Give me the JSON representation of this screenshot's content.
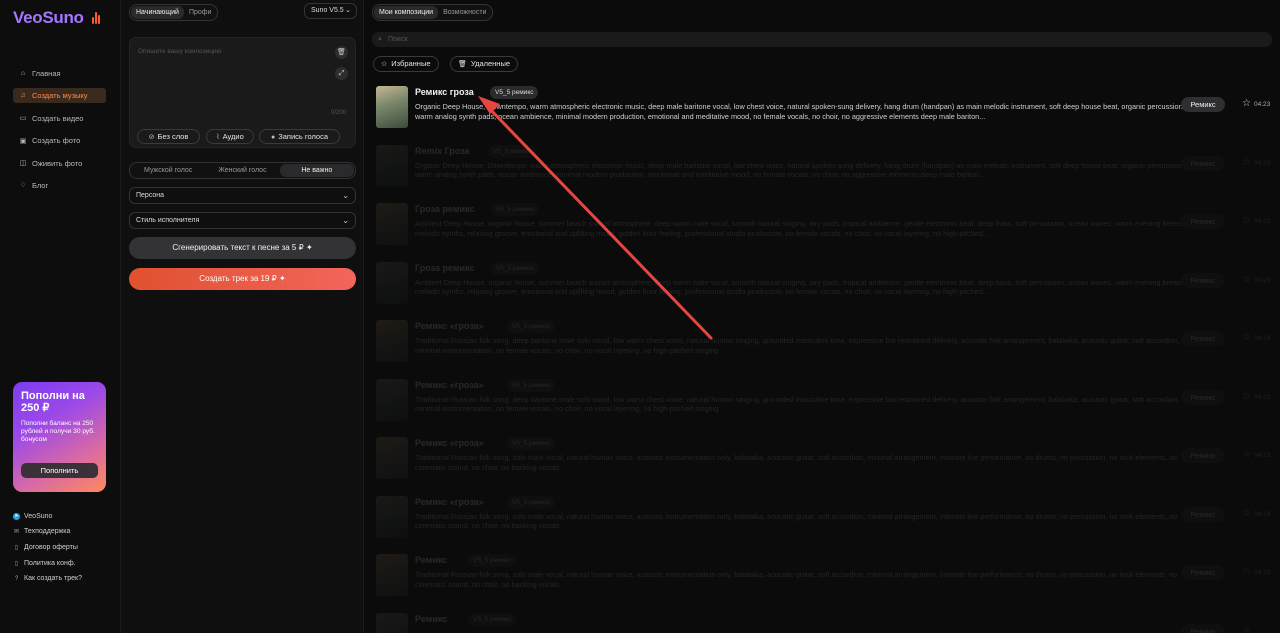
{
  "brand": {
    "name": "VeoSuno",
    "color": "#a576ff"
  },
  "sidebar": {
    "items": [
      {
        "label": "Главная",
        "icon": "home-icon",
        "active": false
      },
      {
        "label": "Создать музыку",
        "icon": "music-note-icon",
        "active": true
      },
      {
        "label": "Создать видео",
        "icon": "video-icon",
        "active": false
      },
      {
        "label": "Создать фото",
        "icon": "photo-icon",
        "active": false
      },
      {
        "label": "Оживить фото",
        "icon": "animate-photo-icon",
        "active": false
      },
      {
        "label": "Блог",
        "icon": "bell-icon",
        "active": false
      }
    ],
    "promo": {
      "title": "Пополни на 250 ₽",
      "text": "Пополни баланс на 250 рублей и получи 30 руб. бонусом",
      "button": "Пополнить"
    },
    "links": [
      {
        "label": "VeoSuno",
        "icon": "telegram-icon"
      },
      {
        "label": "Техподдержка",
        "icon": "support-icon"
      },
      {
        "label": "Договор оферты",
        "icon": "document-icon"
      },
      {
        "label": "Политика конф.",
        "icon": "document-icon"
      },
      {
        "label": "Как создать трек?",
        "icon": "help-icon"
      }
    ]
  },
  "panel": {
    "mode_tabs": [
      "Начинающий",
      "Профи"
    ],
    "mode_selected": "Начинающий",
    "model": "Suno V5.5",
    "prompt_placeholder": "Опишите вашу композицию",
    "char_count": "0/200",
    "input_chips": [
      "Без слов",
      "Аудио",
      "Запись голоса"
    ],
    "voice_options": [
      "Мужской голос",
      "Женский голос",
      "Не важно"
    ],
    "voice_selected": "Не важно",
    "persona_label": "Персона",
    "style_label": "Стиль исполнителя",
    "generate_lyrics": "Сгенерировать текст к песне за 5 ₽",
    "create_track": "Создать трек за 19 ₽"
  },
  "main": {
    "tabs": [
      "Мои композиции",
      "Возможности"
    ],
    "tab_selected": "Мои композиции",
    "search_placeholder": "Поиск",
    "filters": [
      "Избранные",
      "Удаленные"
    ],
    "remix_label": "Ремикс",
    "tracks": [
      {
        "title": "Ремикс гроза",
        "badge": "V5_5 ремикс",
        "duration": "04:23",
        "desc": "Organic Deep House, Downtempo, warm atmospheric electronic music, deep male baritone vocal, low chest voice, natural spoken-sung delivery, hang drum (handpan) as main melodic instrument, soft deep house beat, organic percussion, warm analog synth pads, ocean ambience, minimal modern production, emotional and meditative mood, no female vocals, no choir, no aggressive elements deep male bariton..."
      },
      {
        "title": "Remix Гроза",
        "badge": "V5_5 ремикс",
        "duration": "04:23",
        "desc": "Organic Deep House, Downtempo, warm atmospheric electronic music, deep male baritone vocal, low chest voice, natural spoken-sung delivery, hang drum (handpan) as main melodic instrument, soft deep house beat, organic percussion, warm analog synth pads, ocean ambience, minimal modern production, emotional and meditative mood, no female vocals, no choir, no aggressive elements deep male bariton..."
      },
      {
        "title": "Гроза ремикс",
        "badge": "V5_5 ремикс",
        "duration": "04:23",
        "desc": "Ambient Deep House, organic house, summer beach sunset atmosphere, deep warm male vocal, smooth natural singing, airy pads, tropical ambience, gentle electronic beat, deep bass, soft percussion, ocean waves, warm evening breeze, melodic synths, relaxing groove, emotional and uplifting mood, golden hour feeling, professional studio production, no female vocals, no choir, no vocal layering, no high-pitched..."
      },
      {
        "title": "Гроза ремикс",
        "badge": "V5_5 ремикс",
        "duration": "04:23",
        "desc": "Ambient Deep House, organic house, summer beach sunset atmosphere, deep warm male vocal, smooth natural singing, airy pads, tropical ambience, gentle electronic beat, deep bass, soft percussion, ocean waves, warm evening breeze, melodic synths, relaxing groove, emotional and uplifting mood, golden hour feeling, professional studio production, no female vocals, no choir, no vocal layering, no high-pitched..."
      },
      {
        "title": "Ремикс «гроза»",
        "badge": "V5_5 ремикс",
        "duration": "04:23",
        "desc": "Traditional Russian folk song, deep baritone male solo vocal, low warm chest voice, natural human singing, grounded masculine tone, expressive but restrained delivery, acoustic folk arrangement, balalaika, acoustic guitar, soft accordion, minimal instrumentation, no female vocals, no choir, no vocal layering, no high-pitched singing"
      },
      {
        "title": "Ремикс «гроза»",
        "badge": "V5_5 ремикс",
        "duration": "04:23",
        "desc": "Traditional Russian folk song, deep baritone male solo vocal, low warm chest voice, natural human singing, grounded masculine tone, expressive but restrained delivery, acoustic folk arrangement, balalaika, acoustic guitar, soft accordion, minimal instrumentation, no female vocals, no choir, no vocal layering, no high-pitched singing"
      },
      {
        "title": "Ремикс «гроза»",
        "badge": "V5_5 ремикс",
        "duration": "04:23",
        "desc": "Traditional Russian folk song, solo male vocal, natural human voice, acoustic instrumentation only, balalaika, acoustic guitar, soft accordion, minimal arrangement, intimate live performance, no drums, no percussion, no rock elements, no cinematic sound, no choir, no backing vocals"
      },
      {
        "title": "Ремикс «гроза»",
        "badge": "V5_5 ремикс",
        "duration": "04:23",
        "desc": "Traditional Russian folk song, solo male vocal, natural human voice, acoustic instrumentation only, balalaika, acoustic guitar, soft accordion, minimal arrangement, intimate live performance, no drums, no percussion, no rock elements, no cinematic sound, no choir, no backing vocals"
      },
      {
        "title": "Ремикс",
        "badge": "V5_5 ремикс",
        "duration": "04:23",
        "desc": "Traditional Russian folk song, solo male vocal, natural human voice, acoustic instrumentation only, balalaika, acoustic guitar, soft accordion, minimal arrangement, intimate live performance, no drums, no percussion, no rock elements, no cinematic sound, no choir, no backing vocals"
      },
      {
        "title": "Ремикс",
        "badge": "V5_5 ремикс",
        "duration": "",
        "desc": ""
      }
    ]
  },
  "colors": {
    "accent": "#ff8a4a",
    "create_button": "#e0512f",
    "arrow": "#e5463f"
  }
}
